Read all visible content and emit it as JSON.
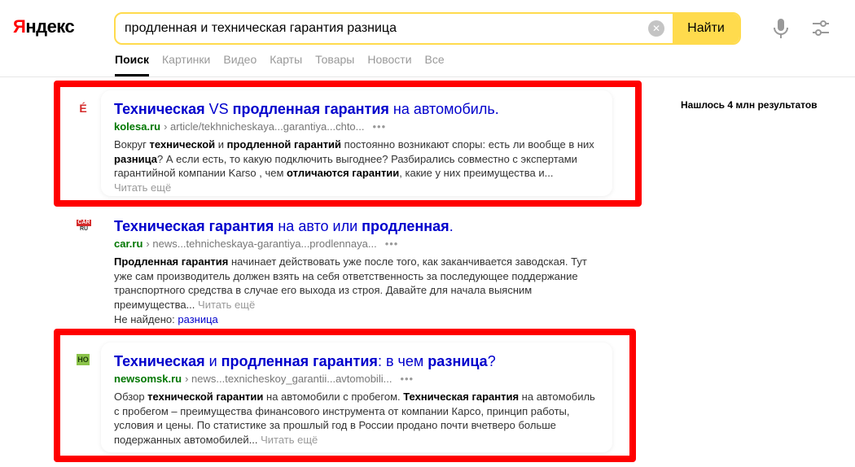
{
  "header": {
    "logo": "Яндекс",
    "search_value": "продленная и техническая гарантия разница",
    "search_button": "Найти"
  },
  "tabs": [
    {
      "label": "Поиск",
      "active": true
    },
    {
      "label": "Картинки"
    },
    {
      "label": "Видео"
    },
    {
      "label": "Карты"
    },
    {
      "label": "Товары"
    },
    {
      "label": "Новости"
    },
    {
      "label": "Все"
    }
  ],
  "found_count": "Нашлось 4 млн результатов",
  "results": [
    {
      "favicon": "É",
      "favicon_color": "#d42a2a",
      "title_parts": [
        [
          "b",
          "Техническая"
        ],
        [
          "n",
          " VS "
        ],
        [
          "b",
          "продленная гарантия"
        ],
        [
          "n",
          " на автомобиль."
        ]
      ],
      "domain": "kolesa.ru",
      "path": "› article/tekhnicheskaya...garantiya...chto...",
      "dots": "•••",
      "snippet_parts": [
        [
          "n",
          "Вокруг "
        ],
        [
          "b",
          "технической"
        ],
        [
          "n",
          " и "
        ],
        [
          "b",
          "продленной гарантий"
        ],
        [
          "n",
          " постоянно возникают споры: есть ли вообще в них "
        ],
        [
          "b",
          "разница"
        ],
        [
          "n",
          "? А если есть, то какую подключить выгоднее? Разбирались совместно с экспертами гарантийной компании Karso , чем "
        ],
        [
          "b",
          "отличаются гарантии"
        ],
        [
          "n",
          ", какие у них преимущества и..."
        ]
      ],
      "read_more": "Читать ещё"
    },
    {
      "favicon": "CAR",
      "favicon_sub": "RU",
      "title_parts": [
        [
          "b",
          "Техническая гарантия"
        ],
        [
          "n",
          " на авто или "
        ],
        [
          "b",
          "продленная"
        ],
        [
          "n",
          "."
        ]
      ],
      "domain": "car.ru",
      "path": "› news...tehnicheskaya-garantiya...prodlennaya...",
      "dots": "•••",
      "snippet_parts": [
        [
          "b",
          "Продленная гарантия"
        ],
        [
          "n",
          " начинает действовать уже после того, как заканчивается заводская. Тут уже сам производитель должен взять на себя ответственность за последующее поддержание транспортного средства в случае его выхода из строя. Давайте для начала выясним преимущества..."
        ]
      ],
      "read_more": "Читать ещё",
      "not_found_label": "Не найдено:",
      "not_found_word": "разница"
    },
    {
      "favicon": "HO",
      "favicon_color": "#4c7a2a",
      "title_parts": [
        [
          "b",
          "Техническая"
        ],
        [
          "n",
          " и "
        ],
        [
          "b",
          "продленная гарантия"
        ],
        [
          "n",
          ": в чем "
        ],
        [
          "b",
          "разница"
        ],
        [
          "n",
          "?"
        ]
      ],
      "domain": "newsomsk.ru",
      "path": "› news...texnicheskoy_garantii...avtomobili...",
      "dots": "•••",
      "snippet_parts": [
        [
          "n",
          "Обзор "
        ],
        [
          "b",
          "технической гарантии"
        ],
        [
          "n",
          " на автомобили с пробегом. "
        ],
        [
          "b",
          "Техническая гарантия"
        ],
        [
          "n",
          " на автомобиль с пробегом – преимущества финансового инструмента от компании Карсо, принцип работы, условия и цены. По статистике за прошлый год в России продано почти вчетверо больше подержанных автомобилей..."
        ]
      ],
      "read_more": "Читать ещё"
    }
  ],
  "colors": {
    "accent": "#ffdb4d",
    "link": "#0000cc",
    "domain": "#007700",
    "frame": "#ff0000"
  }
}
